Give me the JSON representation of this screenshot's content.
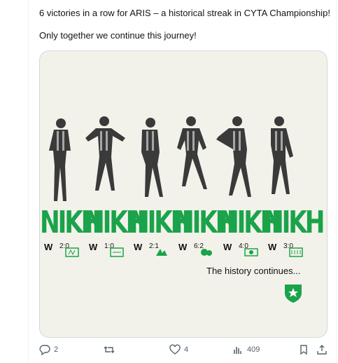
{
  "tweet": {
    "line1": "6 victories in a row for ARIS – a historical streak in CYTA Championship!",
    "line2": "Only together we continue this journey!"
  },
  "graphic": {
    "banner_word": "NIKH",
    "results": [
      {
        "w": "W",
        "score": "2:0"
      },
      {
        "w": "W",
        "score": "1:0"
      },
      {
        "w": "W",
        "score": "2:1"
      },
      {
        "w": "W",
        "score": "6:2"
      },
      {
        "w": "W",
        "score": "4:0"
      },
      {
        "w": "W",
        "score": "3:0"
      }
    ],
    "tagline": "The history continues...",
    "accent_color": "#1aa34a"
  },
  "actions": {
    "replies": "2",
    "reposts": "",
    "likes": "4",
    "views": "409"
  },
  "icons": [
    "reply-icon",
    "repost-icon",
    "like-icon",
    "views-icon",
    "bookmark-icon",
    "share-icon",
    "club-crest-icon"
  ]
}
